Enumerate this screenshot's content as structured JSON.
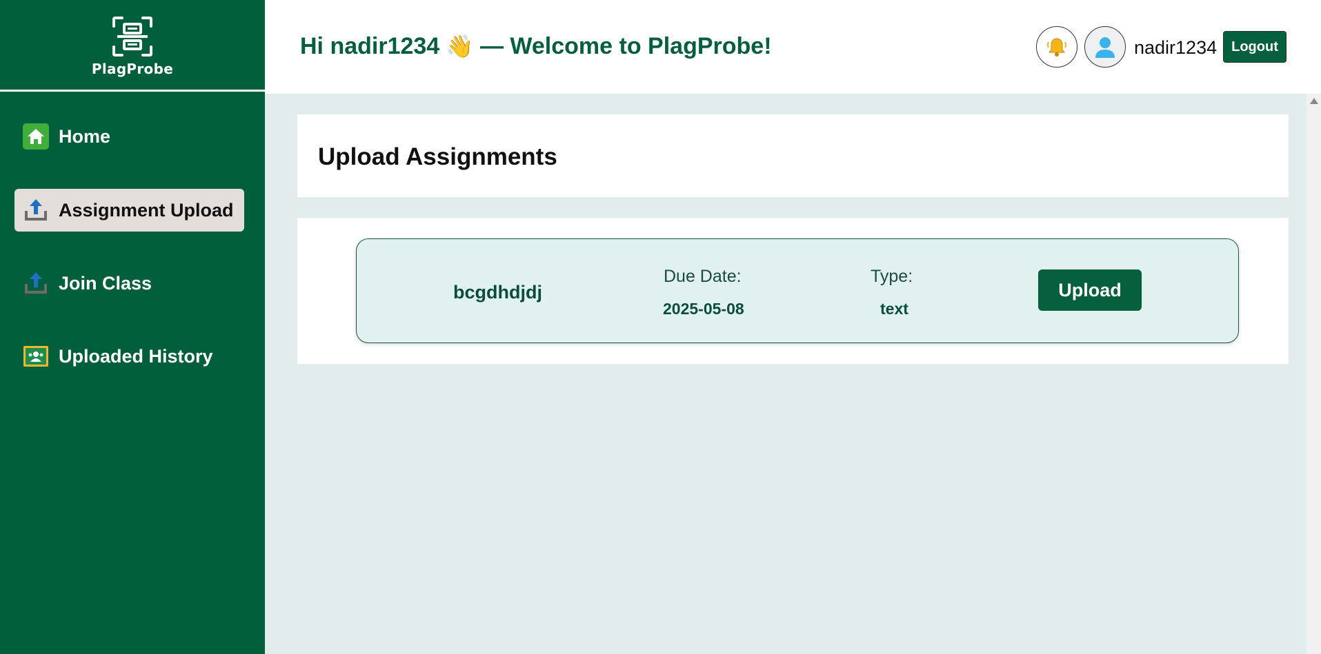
{
  "brand": {
    "name": "PlagProbe",
    "logo_icon": "scan-document-icon"
  },
  "sidebar": {
    "items": [
      {
        "label": "Home",
        "icon": "home-icon",
        "active": false
      },
      {
        "label": "Assignment Upload",
        "icon": "upload-tray-icon",
        "active": true
      },
      {
        "label": "Join Class",
        "icon": "upload-tray-icon",
        "active": false
      },
      {
        "label": "Uploaded History",
        "icon": "classroom-board-icon",
        "active": false
      }
    ]
  },
  "header": {
    "greeting_prefix": "Hi nadir1234",
    "wave": "👋",
    "greeting_suffix": "— Welcome to PlagProbe!",
    "username": "nadir1234",
    "logout_label": "Logout",
    "bell_icon": "bell-icon",
    "avatar_icon": "user-avatar-icon"
  },
  "page": {
    "title": "Upload Assignments"
  },
  "assignments": [
    {
      "name": "bcgdhdjdj",
      "due_label": "Due Date:",
      "due_value": "2025-05-08",
      "type_label": "Type:",
      "type_value": "text",
      "action_label": "Upload"
    }
  ],
  "colors": {
    "sidebar_bg": "#025f3c",
    "accent": "#065f3d",
    "active_item_bg": "#e4dedb",
    "content_bg": "#e2ecec",
    "row_bg": "#e0f1f0"
  }
}
